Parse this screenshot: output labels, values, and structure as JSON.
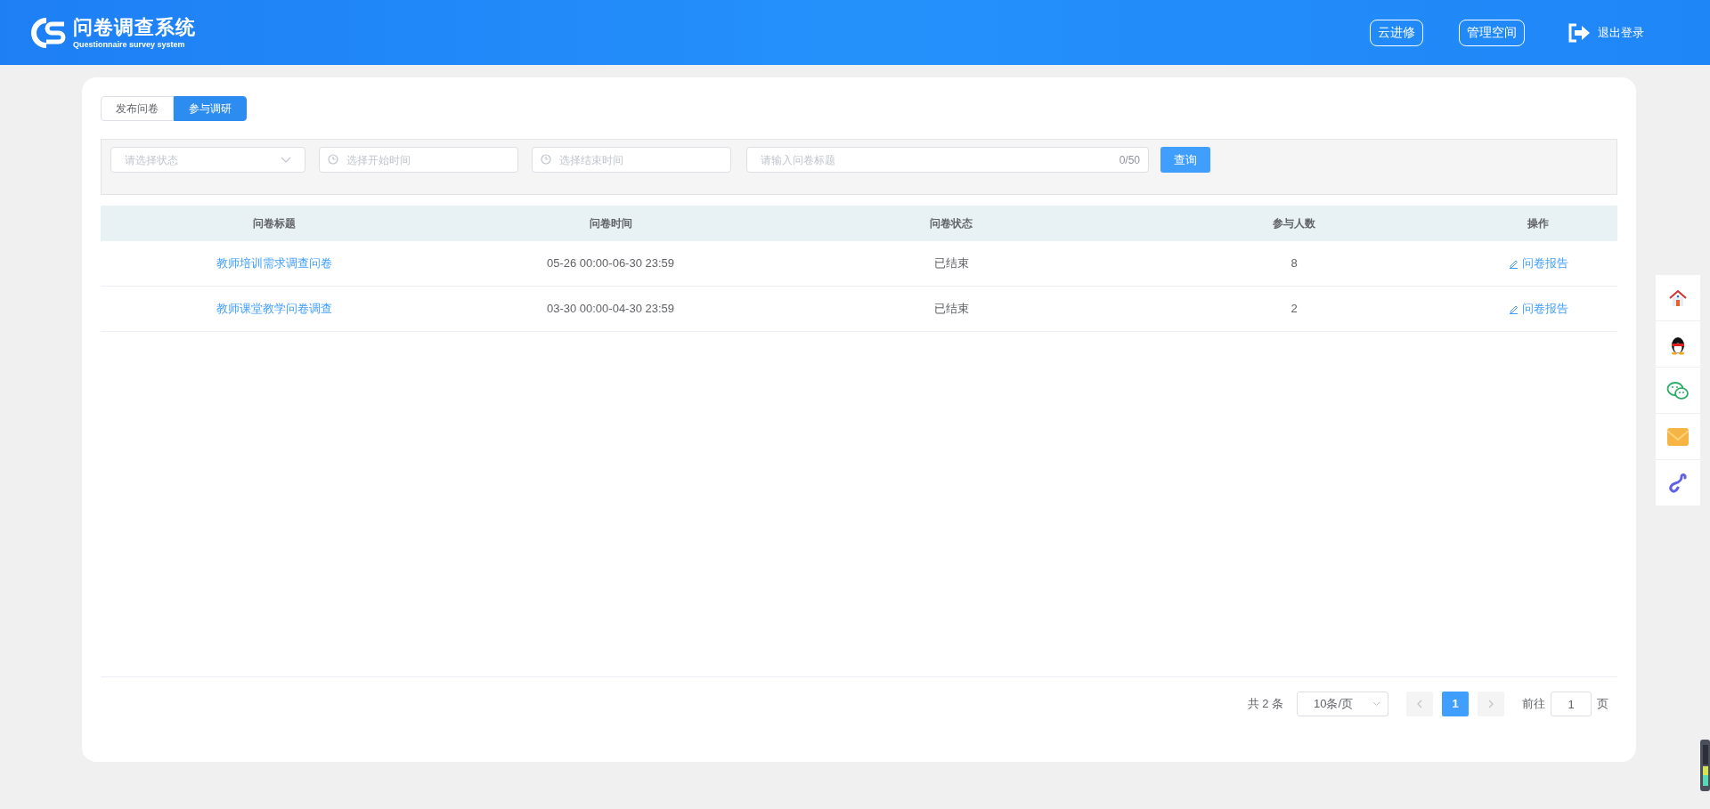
{
  "header": {
    "logo_title": "问卷调查系统",
    "logo_subtitle": "Questionnaire survey system",
    "buttons": [
      "云进修",
      "管理空间"
    ],
    "logout": "退出登录"
  },
  "tabs": [
    {
      "label": "发布问卷",
      "selected": false
    },
    {
      "label": "参与调研",
      "selected": true
    }
  ],
  "filters": {
    "status": {
      "placeholder": "请选择状态"
    },
    "start": {
      "placeholder": "选择开始时间"
    },
    "end": {
      "placeholder": "选择结束时间"
    },
    "title": {
      "placeholder": "请输入问卷标题",
      "count": "0/50"
    },
    "search_button": "查询"
  },
  "table": {
    "columns": [
      "问卷标题",
      "问卷时间",
      "问卷状态",
      "参与人数",
      "操作"
    ],
    "rows": [
      {
        "title": "教师培训需求调查问卷",
        "time": "05-26 00:00-06-30 23:59",
        "status": "已结束",
        "count": "8",
        "action": "问卷报告"
      },
      {
        "title": "教师课堂教学问卷调查",
        "time": "03-30 00:00-04-30 23:59",
        "status": "已结束",
        "count": "2",
        "action": "问卷报告"
      }
    ]
  },
  "pagination": {
    "total": "共 2 条",
    "page_size": "10条/页",
    "pages": [
      {
        "label": "1",
        "selected": true
      }
    ],
    "goto_label": "前往",
    "goto_value": "1",
    "goto_suffix": "页"
  },
  "side_toolbar": [
    {
      "kind": "home"
    },
    {
      "kind": "qq"
    },
    {
      "kind": "wechat"
    },
    {
      "kind": "mail"
    },
    {
      "kind": "link"
    }
  ]
}
